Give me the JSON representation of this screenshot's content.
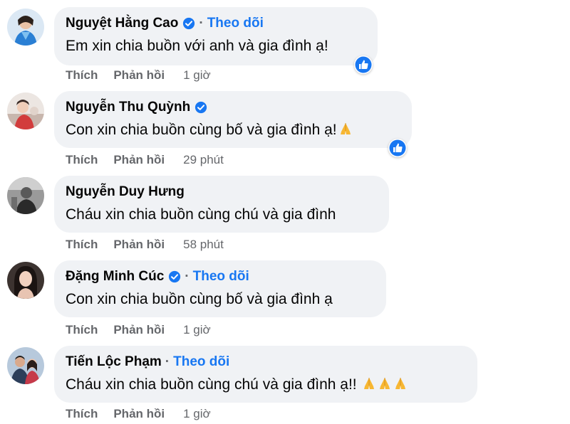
{
  "comments": [
    {
      "author": "Nguyệt Hằng Cao",
      "verified": true,
      "follow_label": "Theo dõi",
      "text": "Em xin chia buồn với anh và gia đình ạ!",
      "like_reaction": true,
      "actions": {
        "like": "Thích",
        "reply": "Phản hồi"
      },
      "time": "1 giờ"
    },
    {
      "author": "Nguyễn Thu Quỳnh",
      "verified": true,
      "text": "Con xin chia buồn cùng bố và gia đình ạ!",
      "emoji": "folded-hands",
      "like_reaction": true,
      "actions": {
        "like": "Thích",
        "reply": "Phản hồi"
      },
      "time": "29 phút"
    },
    {
      "author": "Nguyễn Duy Hưng",
      "verified": false,
      "text": "Cháu xin chia buồn cùng chú và gia đình",
      "actions": {
        "like": "Thích",
        "reply": "Phản hồi"
      },
      "time": "58 phút"
    },
    {
      "author": "Đặng Minh Cúc",
      "verified": true,
      "follow_label": "Theo dõi",
      "text": "Con xin chia buồn cùng bố và gia đình ạ",
      "actions": {
        "like": "Thích",
        "reply": "Phản hồi"
      },
      "time": "1 giờ"
    },
    {
      "author": "Tiến Lộc Phạm",
      "verified": false,
      "follow_label": "Theo dõi",
      "text": "Cháu xin chia buồn cùng chú và gia đình ạ!!",
      "emoji": "folded-hands x3",
      "actions": {
        "like": "Thích",
        "reply": "Phản hồi"
      },
      "time": "1 giờ"
    }
  ],
  "colors": {
    "bubble": "#f0f2f5",
    "follow": "#1877f2",
    "verified": "#1877f2",
    "meta": "#65676b"
  }
}
